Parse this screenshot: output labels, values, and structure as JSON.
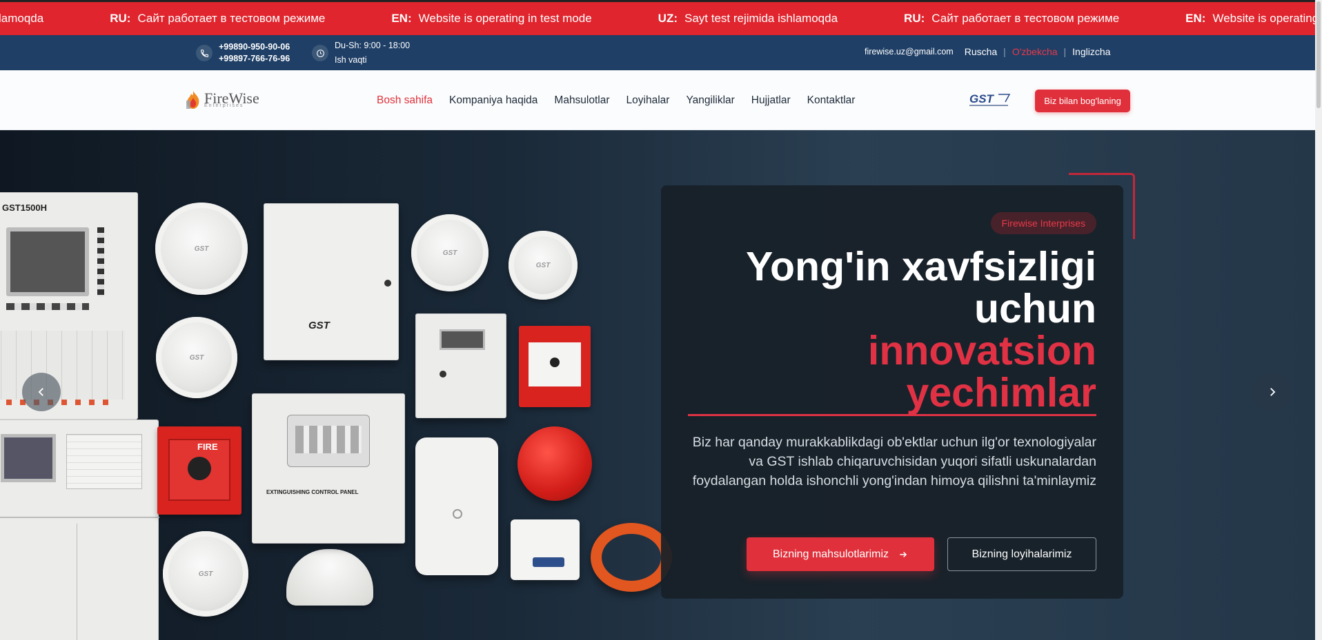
{
  "ticker": {
    "items": [
      {
        "lang": "",
        "text": "lamoqda"
      },
      {
        "lang": "RU:",
        "text": "Сайт работает в тестовом режиме"
      },
      {
        "lang": "EN:",
        "text": "Website is operating in test mode"
      },
      {
        "lang": "UZ:",
        "text": "Sayt test rejimida ishlamoqda"
      },
      {
        "lang": "RU:",
        "text": "Сайт работает в тестовом режиме"
      },
      {
        "lang": "EN:",
        "text": "Website is operating i"
      }
    ]
  },
  "infobar": {
    "phone1": "+99890-950-90-06",
    "phone2": "+99897-766-76-96",
    "hours": "Du-Sh: 9:00 - 18:00",
    "hours_label": "Ish vaqti",
    "email": "firewise.uz@gmail.com",
    "languages": [
      "Ruscha",
      "O'zbekcha",
      "Inglizcha"
    ]
  },
  "nav": {
    "logo_text": "FireWise",
    "logo_sub": "Enterprises",
    "links": [
      "Bosh sahifa",
      "Kompaniya haqida",
      "Mahsulotlar",
      "Loyihalar",
      "Yangiliklar",
      "Hujjatlar",
      "Kontaktlar"
    ],
    "partner_logo": "GST",
    "cta": "Biz bilan bog'laning"
  },
  "hero": {
    "badge": "Firewise Interprises",
    "title_line1": "Yong'in xavfsizligi",
    "title_line2": "uchun",
    "title_red1": "innovatsion",
    "title_red2": "yechimlar",
    "description": "Biz har qanday murakkablikdagi ob'ektlar uchun ilg'or texnologiyalar va GST ishlab chiqaruvchisidan yuqori sifatli uskunalardan foydalangan holda ishonchli yong'indan himoya qilishni ta'minlaymiz",
    "btn_products": "Bizning mahsulotlarimiz",
    "btn_projects": "Bizning loyihalarimiz",
    "image_labels": {
      "panel": "GST1500H",
      "gst": "GST",
      "fire": "FIRE",
      "control": "EXTINGUISHING CONTROL PANEL"
    }
  },
  "colors": {
    "accent": "#e0303b",
    "navy": "#1f3f66",
    "ticker": "#e0252e"
  }
}
